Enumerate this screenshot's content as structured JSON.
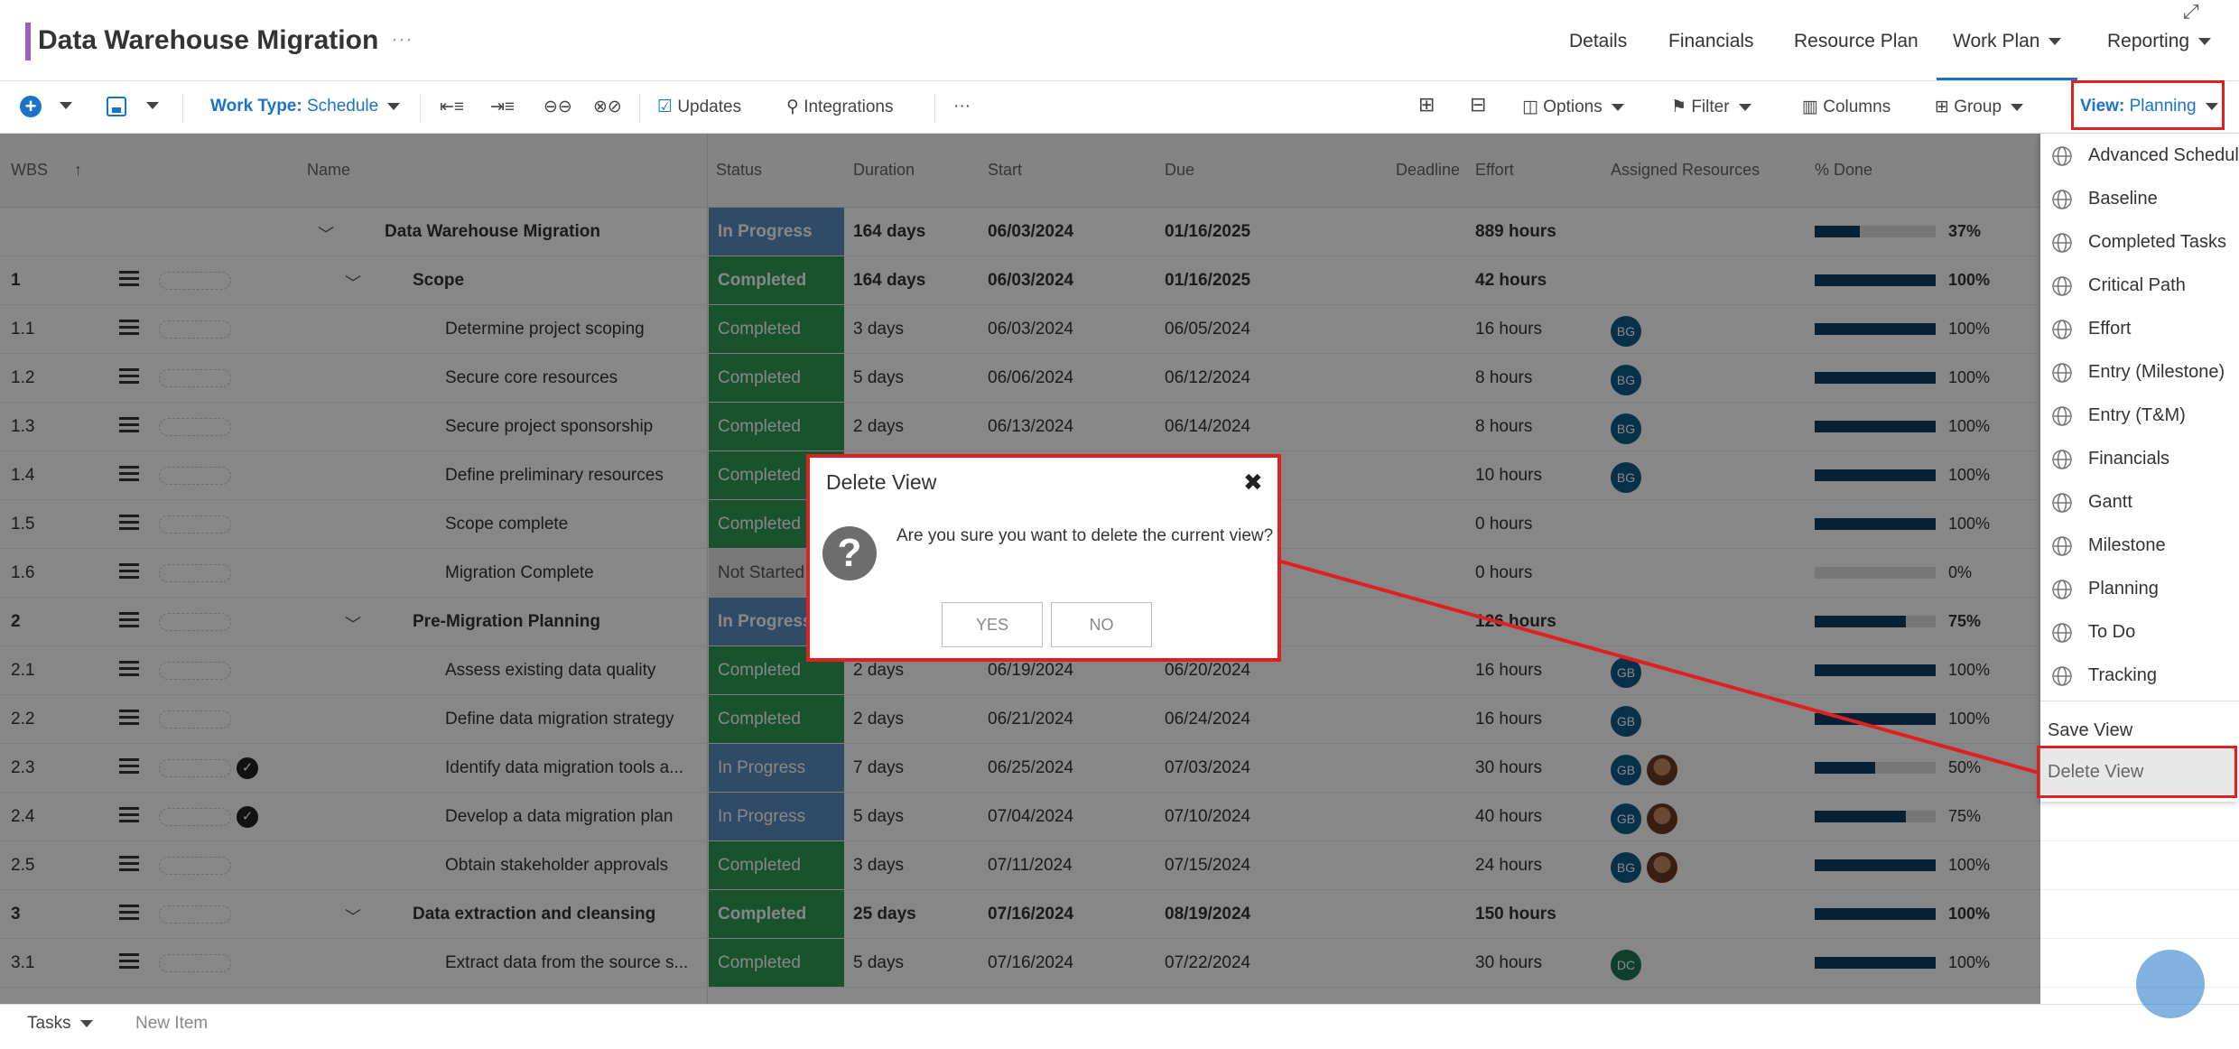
{
  "header": {
    "project_title": "Data Warehouse Migration",
    "title_more": "···",
    "nav": [
      "Details",
      "Financials",
      "Resource Plan",
      "Work Plan",
      "Reporting"
    ],
    "expand_icon": "expand-icon"
  },
  "toolbar": {
    "work_type_label": "Work Type:",
    "work_type_value": "Schedule",
    "updates": "Updates",
    "integrations": "Integrations",
    "more": "···",
    "options": "Options",
    "filter": "Filter",
    "columns": "Columns",
    "group": "Group",
    "view_label": "View:",
    "view_value": "Planning"
  },
  "columns": {
    "wbs": "WBS",
    "name": "Name",
    "status": "Status",
    "duration": "Duration",
    "start": "Start",
    "due": "Due",
    "deadline": "Deadline",
    "effort": "Effort",
    "assigned": "Assigned Resources",
    "done": "% Done"
  },
  "rows": [
    {
      "wbs": "",
      "name": "Data Warehouse Migration",
      "status": "In Progress",
      "duration": "164 days",
      "start": "06/03/2024",
      "due": "01/16/2025",
      "effort": "889 hours",
      "pct": "37%",
      "pct_value": 37
    },
    {
      "wbs": "1",
      "name": "Scope",
      "status": "Completed",
      "duration": "164 days",
      "start": "06/03/2024",
      "due": "01/16/2025",
      "effort": "42 hours",
      "pct": "100%",
      "pct_value": 100
    },
    {
      "wbs": "1.1",
      "name": "Determine project scoping",
      "status": "Completed",
      "duration": "3 days",
      "start": "06/03/2024",
      "due": "06/05/2024",
      "effort": "16 hours",
      "pct": "100%",
      "pct_value": 100,
      "avatars": [
        "BG"
      ]
    },
    {
      "wbs": "1.2",
      "name": "Secure core resources",
      "status": "Completed",
      "duration": "5 days",
      "start": "06/06/2024",
      "due": "06/12/2024",
      "effort": "8 hours",
      "pct": "100%",
      "pct_value": 100,
      "avatars": [
        "BG"
      ]
    },
    {
      "wbs": "1.3",
      "name": "Secure project sponsorship",
      "status": "Completed",
      "duration": "2 days",
      "start": "06/13/2024",
      "due": "06/14/2024",
      "effort": "8 hours",
      "pct": "100%",
      "pct_value": 100,
      "avatars": [
        "BG"
      ]
    },
    {
      "wbs": "1.4",
      "name": "Define preliminary resources",
      "status": "Completed",
      "duration": "",
      "start": "",
      "due": "",
      "effort": "10 hours",
      "pct": "100%",
      "pct_value": 100,
      "avatars": [
        "BG"
      ]
    },
    {
      "wbs": "1.5",
      "name": "Scope complete",
      "status": "Completed",
      "duration": "",
      "start": "",
      "due": "",
      "effort": "0 hours",
      "pct": "100%",
      "pct_value": 100
    },
    {
      "wbs": "1.6",
      "name": "Migration Complete",
      "status": "Not Started",
      "duration": "",
      "start": "",
      "due": "",
      "effort": "0 hours",
      "pct": "0%",
      "pct_value": 0
    },
    {
      "wbs": "2",
      "name": "Pre-Migration Planning",
      "status": "In Progress",
      "duration": "",
      "start": "",
      "due": "",
      "effort": "126 hours",
      "pct": "75%",
      "pct_value": 75
    },
    {
      "wbs": "2.1",
      "name": "Assess existing data quality",
      "status": "Completed",
      "duration": "2 days",
      "start": "06/19/2024",
      "due": "06/20/2024",
      "effort": "16 hours",
      "pct": "100%",
      "pct_value": 100,
      "avatars": [
        "GB"
      ]
    },
    {
      "wbs": "2.2",
      "name": "Define data migration strategy",
      "status": "Completed",
      "duration": "2 days",
      "start": "06/21/2024",
      "due": "06/24/2024",
      "effort": "16 hours",
      "pct": "100%",
      "pct_value": 100,
      "avatars": [
        "GB"
      ]
    },
    {
      "wbs": "2.3",
      "name": "Identify data migration tools a...",
      "status": "In Progress",
      "duration": "7 days",
      "start": "06/25/2024",
      "due": "07/03/2024",
      "effort": "30 hours",
      "pct": "50%",
      "pct_value": 50,
      "avatars": [
        "GB",
        "photo"
      ]
    },
    {
      "wbs": "2.4",
      "name": "Develop a data migration plan",
      "status": "In Progress",
      "duration": "5 days",
      "start": "07/04/2024",
      "due": "07/10/2024",
      "effort": "40 hours",
      "pct": "75%",
      "pct_value": 75,
      "avatars": [
        "GB",
        "photo"
      ]
    },
    {
      "wbs": "2.5",
      "name": "Obtain stakeholder approvals",
      "status": "Completed",
      "duration": "3 days",
      "start": "07/11/2024",
      "due": "07/15/2024",
      "effort": "24 hours",
      "pct": "100%",
      "pct_value": 100,
      "avatars": [
        "BG",
        "photo"
      ]
    },
    {
      "wbs": "3",
      "name": "Data extraction and cleansing",
      "status": "Completed",
      "duration": "25 days",
      "start": "07/16/2024",
      "due": "08/19/2024",
      "effort": "150 hours",
      "pct": "100%",
      "pct_value": 100
    },
    {
      "wbs": "3.1",
      "name": "Extract data from the source s...",
      "status": "Completed",
      "duration": "5 days",
      "start": "07/16/2024",
      "due": "07/22/2024",
      "effort": "30 hours",
      "pct": "100%",
      "pct_value": 100,
      "avatars": [
        "DC"
      ]
    }
  ],
  "footer": {
    "tasks": "Tasks",
    "new_item": "New Item"
  },
  "view_menu": {
    "views": [
      "Advanced Scheduling",
      "Baseline",
      "Completed Tasks",
      "Critical Path",
      "Effort",
      "Entry (Milestone)",
      "Entry (T&M)",
      "Financials",
      "Gantt",
      "Milestone",
      "Planning",
      "To Do",
      "Tracking"
    ],
    "save_view": "Save View",
    "delete_view": "Delete View"
  },
  "dialog": {
    "title": "Delete View",
    "close": "✖",
    "message": "Are you sure you want to delete the current view?",
    "yes": "YES",
    "no": "NO",
    "icon": "question-icon"
  },
  "colors": {
    "accent": "#1a73c9",
    "completed": "#2e9e57",
    "in_progress": "#5b8fc0",
    "highlight": "#e02020",
    "title_bar": "#9b5fc0"
  }
}
